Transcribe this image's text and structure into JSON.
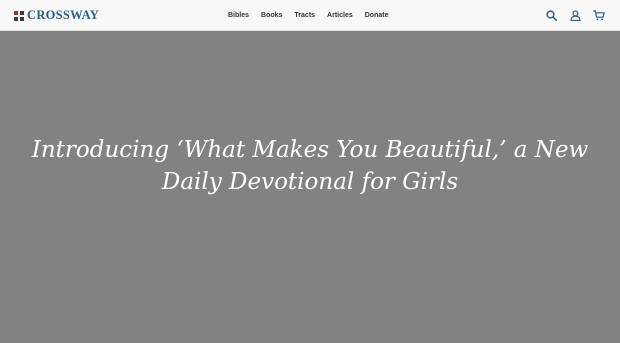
{
  "header": {
    "logo_text": "CROSSWAY",
    "nav": [
      {
        "label": "Bibles"
      },
      {
        "label": "Books"
      },
      {
        "label": "Tracts"
      },
      {
        "label": "Articles"
      },
      {
        "label": "Donate"
      }
    ],
    "icons": [
      "search-icon",
      "account-icon",
      "cart-icon"
    ]
  },
  "hero": {
    "title_line1": "Introducing ‘What Makes You Beautiful,’ a New",
    "title_line2": "Daily Devotional for Girls"
  },
  "colors": {
    "header_bg": "#f8f8f8",
    "brand_blue": "#2a5d8a",
    "brand_red": "#9a3324",
    "brand_dark": "#3b3b3b",
    "hero_bg": "#828282",
    "hero_text": "#ffffff"
  }
}
